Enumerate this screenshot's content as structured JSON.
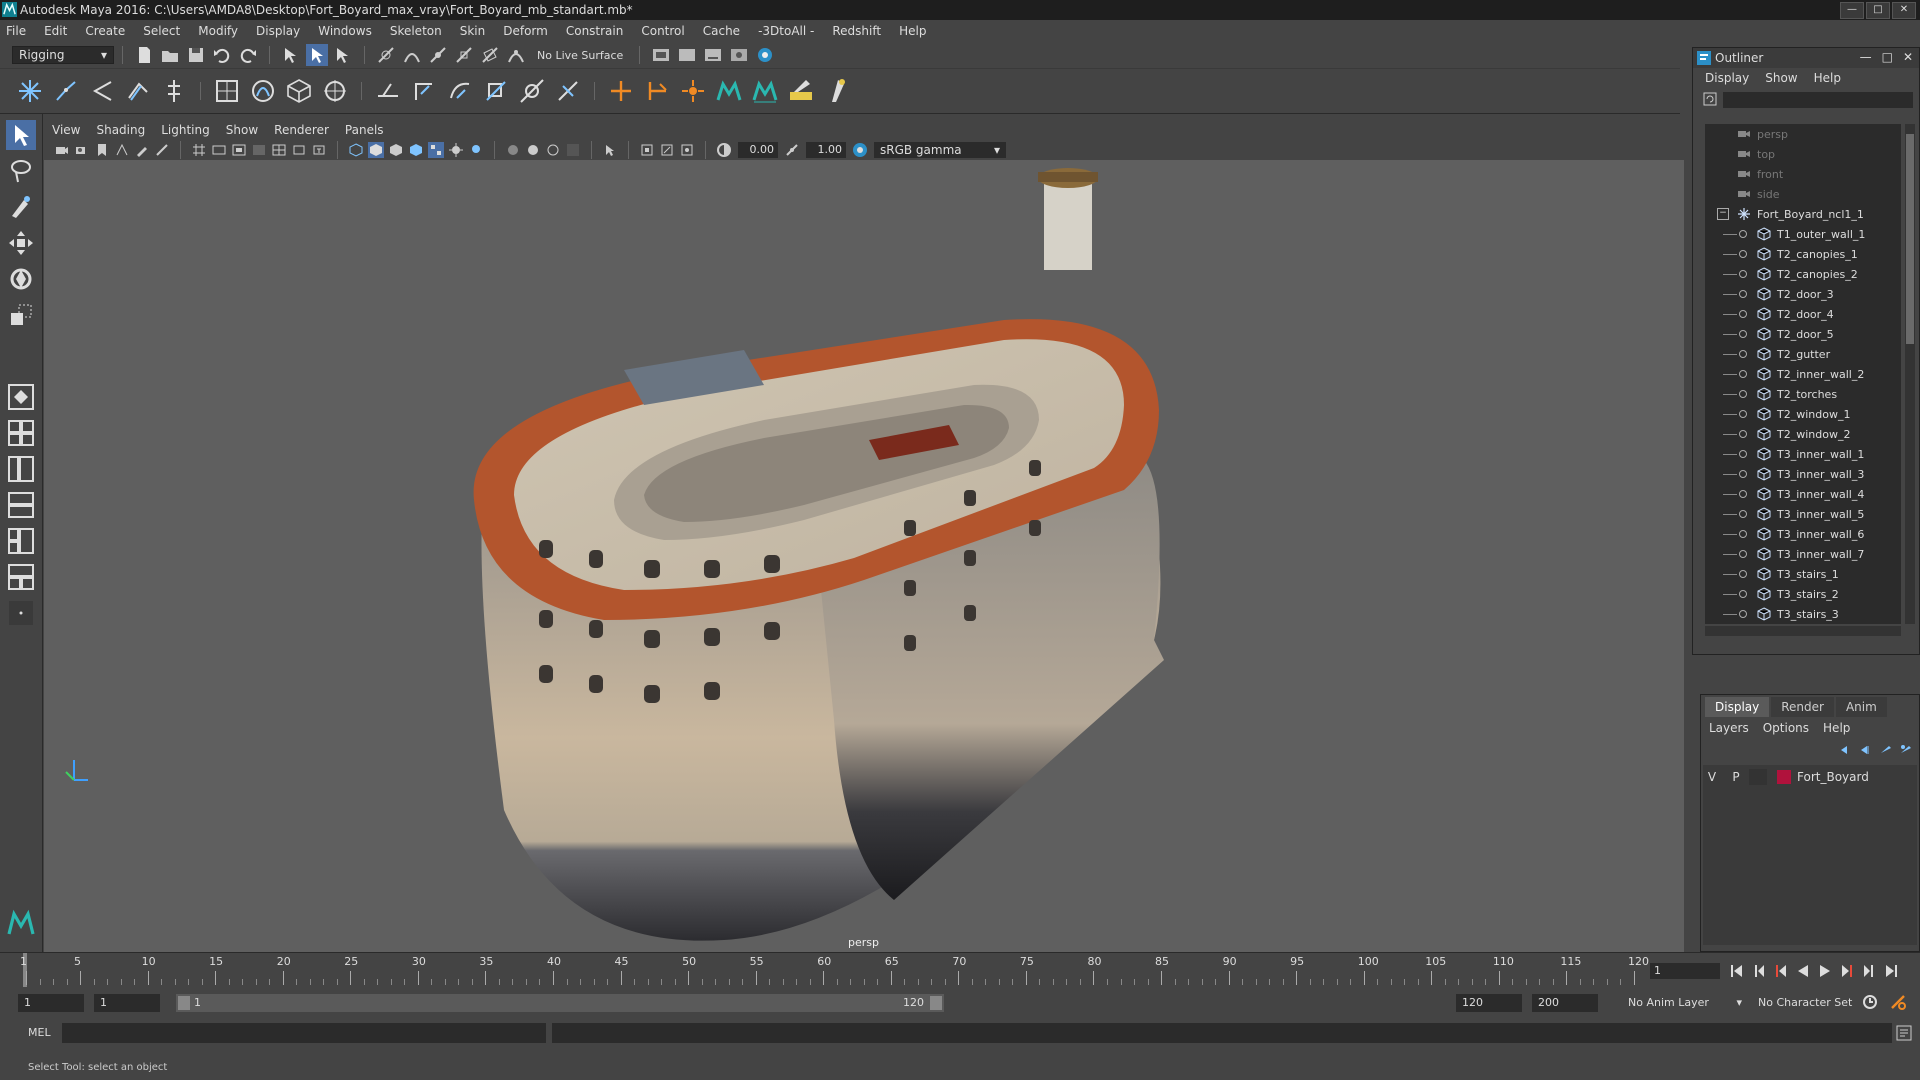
{
  "window": {
    "title": "Autodesk Maya 2016: C:\\Users\\AMDA8\\Desktop\\Fort_Boyard_max_vray\\Fort_Boyard_mb_standart.mb*"
  },
  "menubar": [
    "File",
    "Edit",
    "Create",
    "Select",
    "Modify",
    "Display",
    "Windows",
    "Skeleton",
    "Skin",
    "Deform",
    "Constrain",
    "Control",
    "Cache",
    "-3DtoAll -",
    "Redshift",
    "Help"
  ],
  "statusline": {
    "mode": "Rigging",
    "live_surface": "No Live Surface"
  },
  "viewport": {
    "menu": [
      "View",
      "Shading",
      "Lighting",
      "Show",
      "Renderer",
      "Panels"
    ],
    "exposure": "0.00",
    "gamma_value": "1.00",
    "color_space": "sRGB gamma",
    "camera_label": "persp"
  },
  "outliner": {
    "title": "Outliner",
    "menu": [
      "Display",
      "Show",
      "Help"
    ],
    "cameras": [
      "persp",
      "top",
      "front",
      "side"
    ],
    "group": "Fort_Boyard_ncl1_1",
    "items": [
      "T1_outer_wall_1",
      "T2_canopies_1",
      "T2_canopies_2",
      "T2_door_3",
      "T2_door_4",
      "T2_door_5",
      "T2_gutter",
      "T2_inner_wall_2",
      "T2_torches",
      "T2_window_1",
      "T2_window_2",
      "T3_inner_wall_1",
      "T3_inner_wall_3",
      "T3_inner_wall_4",
      "T3_inner_wall_5",
      "T3_inner_wall_6",
      "T3_inner_wall_7",
      "T3_stairs_1",
      "T3_stairs_2",
      "T3_stairs_3"
    ]
  },
  "layers": {
    "tabs": [
      "Display",
      "Render",
      "Anim"
    ],
    "menu": [
      "Layers",
      "Options",
      "Help"
    ],
    "row": {
      "v": "V",
      "p": "P",
      "name": "Fort_Boyard",
      "color": "#b0123c"
    }
  },
  "timeslider": {
    "labels": [
      "1",
      "5",
      "10",
      "15",
      "20",
      "25",
      "30",
      "35",
      "40",
      "45",
      "50",
      "55",
      "60",
      "65",
      "70",
      "75",
      "80",
      "85",
      "90",
      "95",
      "100",
      "105",
      "110",
      "115",
      "120"
    ],
    "current_frame": "1"
  },
  "rangeslider": {
    "start": "1",
    "playback_start": "1",
    "range_start_label": "1",
    "range_end_label": "120",
    "playback_end": "120",
    "end": "200",
    "anim_layer": "No Anim Layer",
    "character_set": "No Character Set"
  },
  "cmdline": {
    "label": "MEL"
  },
  "helpline": {
    "text": "Select Tool: select an object"
  }
}
